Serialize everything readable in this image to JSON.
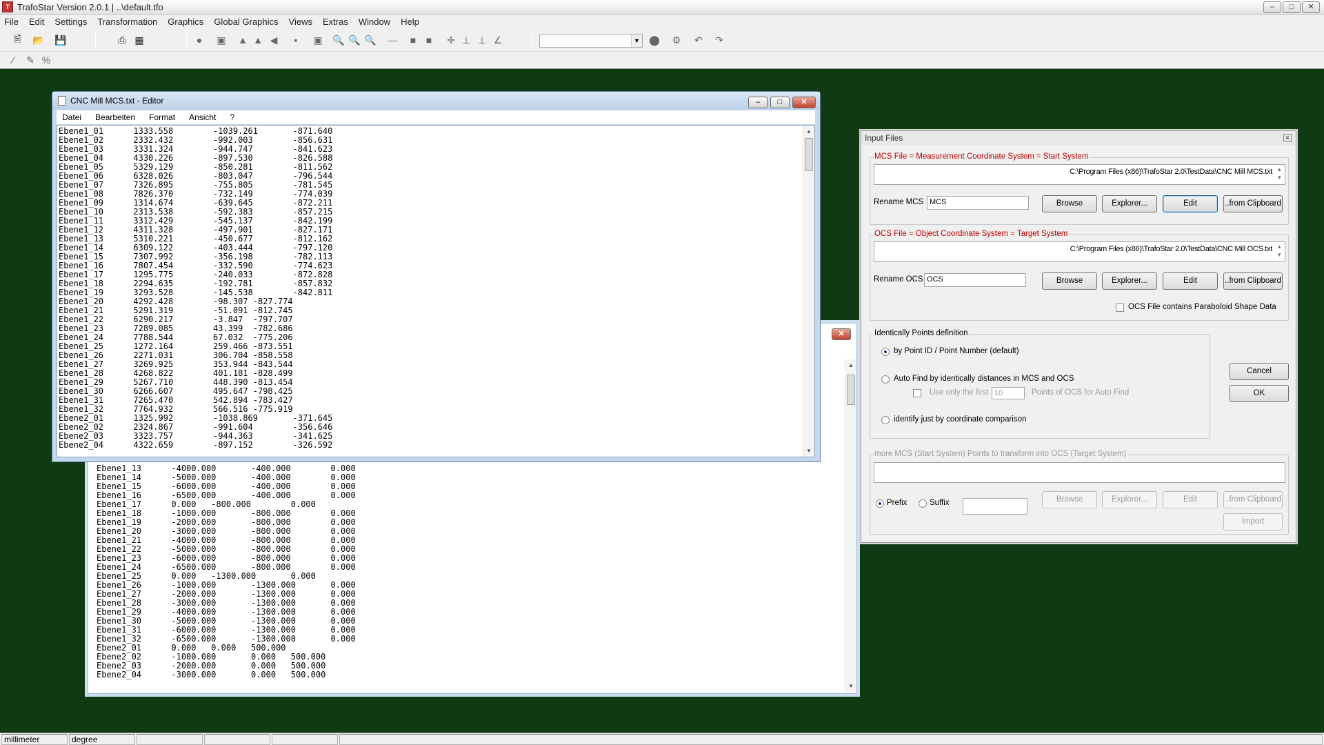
{
  "window": {
    "title": "TrafoStar Version 2.0.1 | ..\\default.tfo",
    "controls": {
      "minimize": "–",
      "maximize": "□",
      "close": "✕"
    }
  },
  "menu": [
    "File",
    "Edit",
    "Settings",
    "Transformation",
    "Graphics",
    "Global Graphics",
    "Views",
    "Extras",
    "Window",
    "Help"
  ],
  "statusbar": [
    "millimeter",
    "degree",
    "",
    "",
    "",
    ""
  ],
  "editor_back": {
    "text": "Ebene1_13      -4000.000       -400.000        0.000\nEbene1_14      -5000.000       -400.000        0.000\nEbene1_15      -6000.000       -400.000        0.000\nEbene1_16      -6500.000       -400.000        0.000\nEbene1_17      0.000   -800.000        0.000\nEbene1_18      -1000.000       -800.000        0.000\nEbene1_19      -2000.000       -800.000        0.000\nEbene1_20      -3000.000       -800.000        0.000\nEbene1_21      -4000.000       -800.000        0.000\nEbene1_22      -5000.000       -800.000        0.000\nEbene1_23      -6000.000       -800.000        0.000\nEbene1_24      -6500.000       -800.000        0.000\nEbene1_25      0.000   -1300.000       0.000\nEbene1_26      -1000.000       -1300.000       0.000\nEbene1_27      -2000.000       -1300.000       0.000\nEbene1_28      -3000.000       -1300.000       0.000\nEbene1_29      -4000.000       -1300.000       0.000\nEbene1_30      -5000.000       -1300.000       0.000\nEbene1_31      -6000.000       -1300.000       0.000\nEbene1_32      -6500.000       -1300.000       0.000\nEbene2_01      0.000   0.000   500.000\nEbene2_02      -1000.000       0.000   500.000\nEbene2_03      -2000.000       0.000   500.000\nEbene2_04      -3000.000       0.000   500.000",
    "close": "✕"
  },
  "editor_front": {
    "title": "CNC Mill MCS.txt - Editor",
    "menu": [
      "Datei",
      "Bearbeiten",
      "Format",
      "Ansicht",
      "?"
    ],
    "text": "Ebene1_01      1333.558        -1039.261       -871.640\nEbene1_02      2332.432        -992.003        -856.631\nEbene1_03      3331.324        -944.747        -841.623\nEbene1_04      4330.226        -897.530        -826.588\nEbene1_05      5329.129        -850.281        -811.562\nEbene1_06      6328.026        -803.047        -796.544\nEbene1_07      7326.895        -755.805        -781.545\nEbene1_08      7826.370        -732.149        -774.039\nEbene1_09      1314.674        -639.645        -872.211\nEbene1_10      2313.538        -592.383        -857.215\nEbene1_11      3312.429        -545.137        -842.199\nEbene1_12      4311.328        -497.901        -827.171\nEbene1_13      5310.221        -450.677        -812.162\nEbene1_14      6309.122        -403.444        -797.120\nEbene1_15      7307.992        -356.198        -782.113\nEbene1_16      7807.454        -332.590        -774.623\nEbene1_17      1295.775        -240.033        -872.828\nEbene1_18      2294.635        -192.781        -857.832\nEbene1_19      3293.528        -145.538        -842.811\nEbene1_20      4292.428        -98.307 -827.774\nEbene1_21      5291.319        -51.091 -812.745\nEbene1_22      6290.217        -3.847  -797.707\nEbene1_23      7289.085        43.399  -782.686\nEbene1_24      7788.544        67.032  -775.206\nEbene1_25      1272.164        259.466 -873.551\nEbene1_26      2271.031        306.704 -858.558\nEbene1_27      3269.925        353.944 -843.544\nEbene1_28      4268.822        401.181 -828.499\nEbene1_29      5267.710        448.390 -813.454\nEbene1_30      6266.607        495.647 -798.425\nEbene1_31      7265.470        542.894 -783.427\nEbene1_32      7764.932        566.516 -775.919\nEbene2_01      1325.992        -1038.869       -371.645\nEbene2_02      2324.867        -991.604        -356.646\nEbene2_03      3323.757        -944.363        -341.625\nEbene2_04      4322.659        -897.152        -326.592"
  },
  "dialog": {
    "title": "Input Files",
    "mcs": {
      "group_label": "MCS File = Measurement Coordinate System = Start System",
      "path": "C:\\Program Files (x86)\\TrafoStar 2.0\\TestData\\CNC Mill MCS.txt",
      "rename_label": "Rename MCS",
      "rename_value": "MCS"
    },
    "ocs": {
      "group_label": "OCS File = Object Coordinate System =  Target System",
      "path": "C:\\Program Files (x86)\\TrafoStar 2.0\\TestData\\CNC Mill OCS.txt",
      "rename_label": "Rename OCS",
      "rename_value": "OCS",
      "paraboloid_label": "OCS File contains Paraboloid Shape Data"
    },
    "buttons": {
      "browse": "Browse",
      "explorer": "Explorer...",
      "edit": "Edit",
      "clipboard": "..from Clipboard",
      "cancel": "Cancel",
      "ok": "OK",
      "import": "Import"
    },
    "ident": {
      "group_label": "Identically Points definition",
      "opt1": "by Point ID / Point Number (default)",
      "opt2": "Auto Find by identically distances in MCS and OCS",
      "use_first": "Use only the first",
      "use_first_value": "10",
      "points_label": "Points of OCS for Auto Find",
      "opt3": "identify just by coordinate comparison"
    },
    "more": {
      "group_label": "more MCS (Start System) Points to transform into OCS (Target System)",
      "prefix": "Prefix",
      "suffix": "Suffix"
    }
  }
}
